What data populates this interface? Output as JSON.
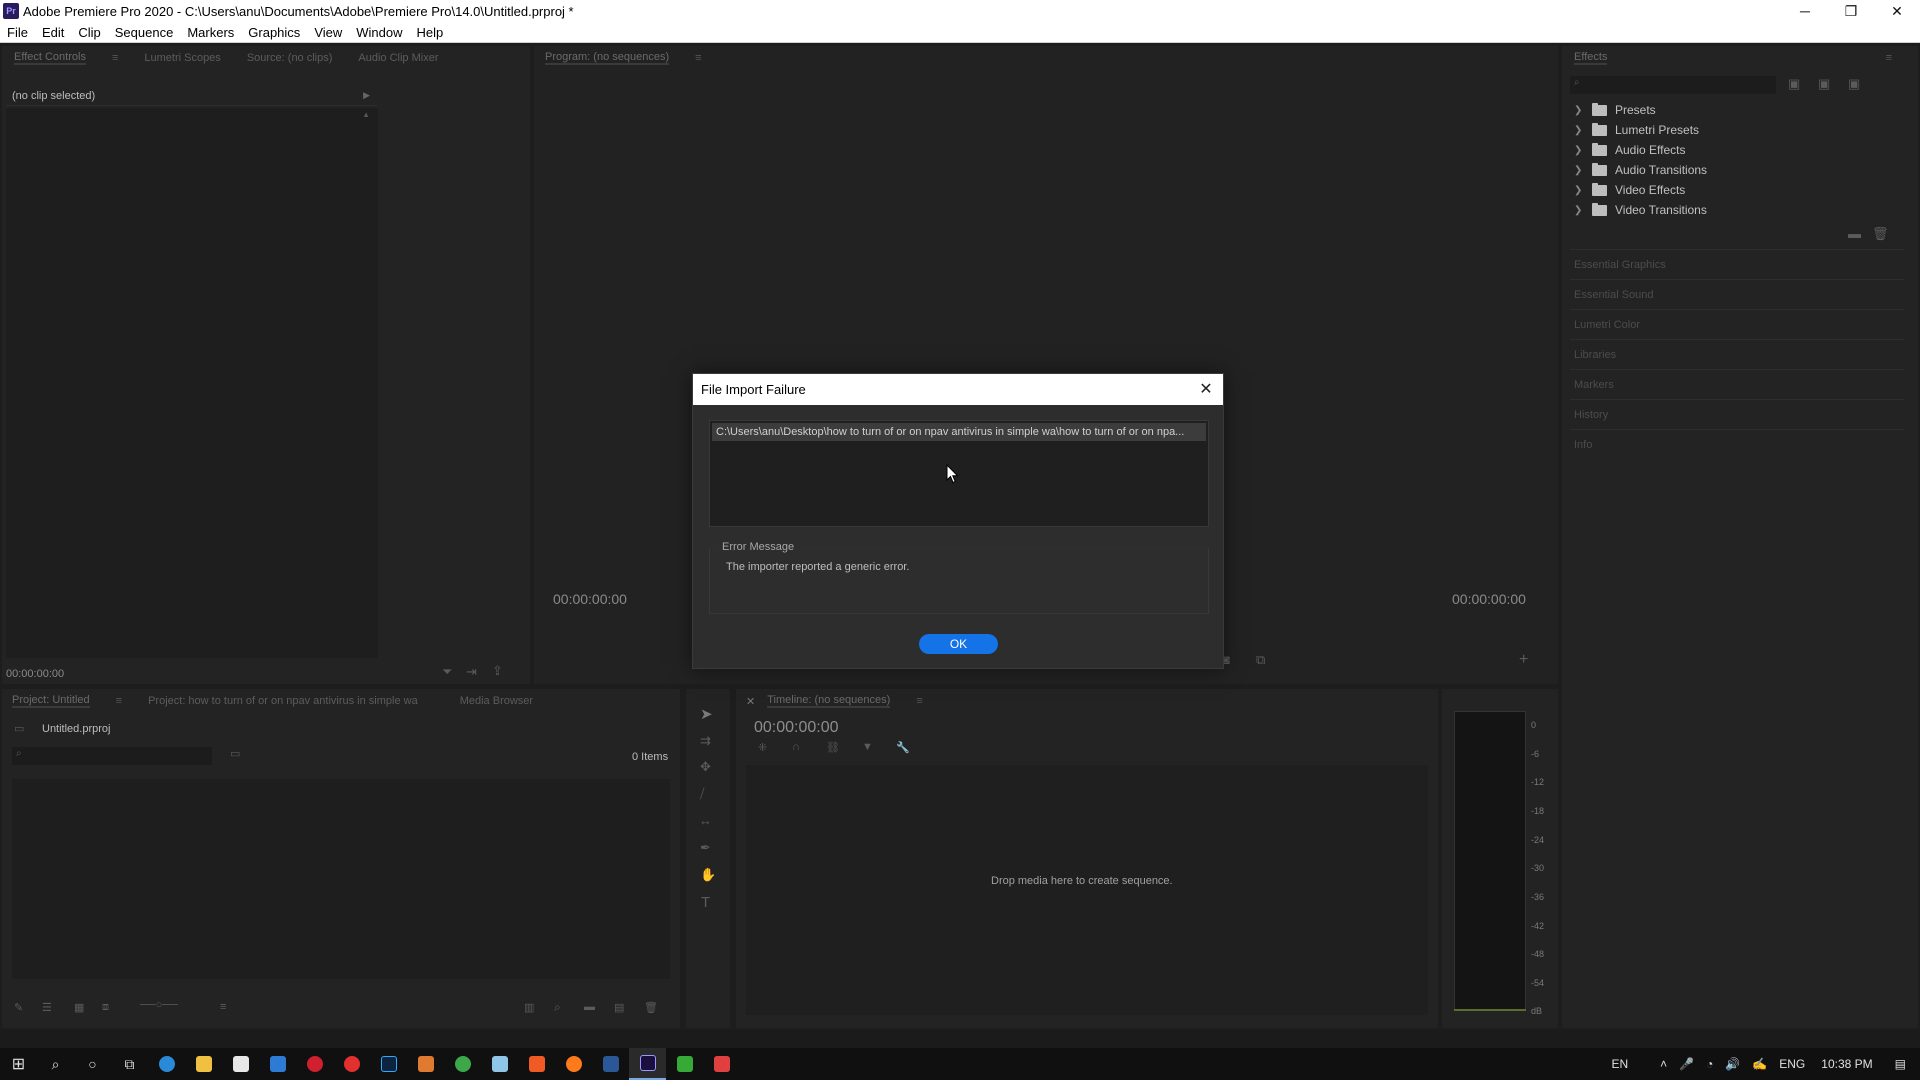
{
  "window": {
    "app_badge": "Pr",
    "title": "Adobe Premiere Pro 2020 - C:\\Users\\anu\\Documents\\Adobe\\Premiere Pro\\14.0\\Untitled.prproj *",
    "minimize": "─",
    "restore": "❐",
    "close": "✕"
  },
  "menu": [
    "File",
    "Edit",
    "Clip",
    "Sequence",
    "Markers",
    "Graphics",
    "View",
    "Window",
    "Help"
  ],
  "source_panel": {
    "tabs": [
      "Effect Controls",
      "Lumetri Scopes",
      "Source: (no clips)",
      "Audio Clip Mixer"
    ],
    "no_clip": "(no clip selected)",
    "timecode": "00:00:00:00"
  },
  "program_panel": {
    "tab": "Program: (no sequences)",
    "timecode_left": "00:00:00:00",
    "timecode_right": "00:00:00:00"
  },
  "effects_panel": {
    "tab": "Effects",
    "items": [
      "Presets",
      "Lumetri Presets",
      "Audio Effects",
      "Audio Transitions",
      "Video Effects",
      "Video Transitions"
    ],
    "sections": [
      "Essential Graphics",
      "Essential Sound",
      "Lumetri Color",
      "Libraries",
      "Markers",
      "History",
      "Info"
    ]
  },
  "project_panel": {
    "tabs": [
      "Project: Untitled",
      "Project: how to turn of or on npav antivirus  in simple  wa",
      "Media Browser"
    ],
    "file": "Untitled.prproj",
    "items_count": "0 Items"
  },
  "timeline_panel": {
    "tab": "Timeline: (no sequences)",
    "timecode": "00:00:00:00",
    "drop_hint": "Drop media here to create sequence."
  },
  "audio_meter": {
    "labels": [
      "0",
      "-6",
      "-12",
      "-18",
      "-24",
      "-30",
      "-36",
      "-42",
      "-48",
      "-54",
      "dB"
    ]
  },
  "dialog": {
    "title": "File Import Failure",
    "file_path": "C:\\Users\\anu\\Desktop\\how to turn of or on npav antivirus  in simple  wa\\how to turn of or on npa...",
    "error_label": "Error Message",
    "error_text": "The importer reported a generic error.",
    "ok_label": "OK",
    "close_glyph": "✕"
  },
  "taskbar": {
    "lang_left": "EN",
    "lang_right": "ENG",
    "time": "10:38 PM"
  },
  "colors": {
    "accent": "#1473e6",
    "panel_bg": "#232323",
    "app_bg": "#1d1d1d"
  }
}
